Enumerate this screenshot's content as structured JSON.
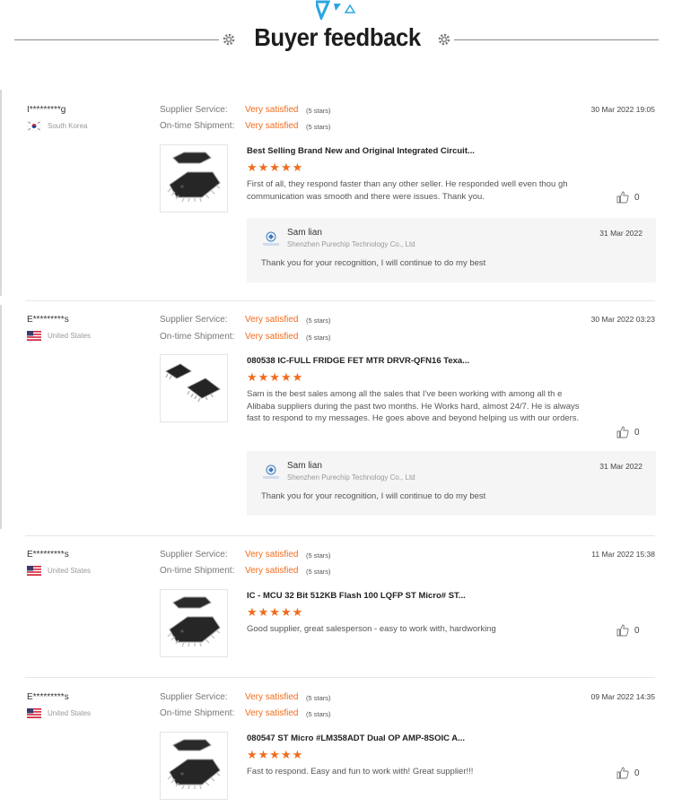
{
  "header": {
    "title": "Buyer feedback"
  },
  "labels": {
    "supplier_service": "Supplier Service:",
    "ontime_shipment": "On-time Shipment:"
  },
  "colors": {
    "accent_orange": "#f26b1d",
    "deco_blue": "#2aa6e0"
  },
  "reviews": [
    {
      "buyer": "I*********g",
      "country": "South Korea",
      "flag": "kr-flag-icon",
      "supplier_rating": "Very satisfied",
      "supplier_stars": "(5 stars)",
      "shipment_rating": "Very satisfied",
      "shipment_stars": "(5 stars)",
      "date": "30 Mar 2022 19:05",
      "product": "Best Selling Brand New and Original Integrated Circuit...",
      "product_icon": "qfp-chip-icon",
      "stars": "★★★★★",
      "rating": 5,
      "comment": "First of all, they respond faster than any other seller. He responded well even thou gh communication was smooth and there were issues. Thank you.",
      "likes": "0",
      "reply": {
        "name": "Sam lian",
        "company": "Shenzhen Purechip Technology Co., Ltd",
        "date": "31 Mar 2022",
        "text": "Thank you for your recognition, I will continue to do my best"
      }
    },
    {
      "buyer": "E*********s",
      "country": "United States",
      "flag": "us-flag-icon",
      "supplier_rating": "Very satisfied",
      "supplier_stars": "(5 stars)",
      "shipment_rating": "Very satisfied",
      "shipment_stars": "(5 stars)",
      "date": "30 Mar 2022 03:23",
      "product": "080538 IC-FULL FRIDGE FET MTR DRVR-QFN16 Texa...",
      "product_icon": "qfn-chip-icon",
      "stars": "★★★★★",
      "rating": 5,
      "comment": "Sam is the best sales among all the sales that I've been working with among all th e Alibaba suppliers during the past two months. He Works hard, almost 24/7.  He is always fast to respond to my messages.  He goes above and beyond helping us with our orders.",
      "likes": "0",
      "reply": {
        "name": "Sam lian",
        "company": "Shenzhen Purechip Technology Co., Ltd",
        "date": "31 Mar 2022",
        "text": "Thank you for your recognition, I will continue to do my best"
      }
    },
    {
      "buyer": "E*********s",
      "country": "United States",
      "flag": "us-flag-icon",
      "supplier_rating": "Very satisfied",
      "supplier_stars": "(5 stars)",
      "shipment_rating": "Very satisfied",
      "shipment_stars": "(5 stars)",
      "date": "11 Mar 2022 15:38",
      "product": "IC - MCU 32 Bit 512KB Flash 100 LQFP ST Micro# ST...",
      "product_icon": "qfp-chip-icon",
      "stars": "★★★★★",
      "rating": 5,
      "comment": "Good supplier, great salesperson - easy to work with, hardworking",
      "likes": "0"
    },
    {
      "buyer": "E*********s",
      "country": "United States",
      "flag": "us-flag-icon",
      "supplier_rating": "Very satisfied",
      "supplier_stars": "(5 stars)",
      "shipment_rating": "Very satisfied",
      "shipment_stars": "(5 stars)",
      "date": "09 Mar 2022 14:35",
      "product": "080547 ST Micro #LM358ADT Dual OP AMP-8SOIC A...",
      "product_icon": "qfp-chip-icon",
      "stars": "★★★★★",
      "rating": 5,
      "comment": "Fast to respond.  Easy and fun to work with!  Great supplier!!!",
      "likes": "0"
    }
  ]
}
